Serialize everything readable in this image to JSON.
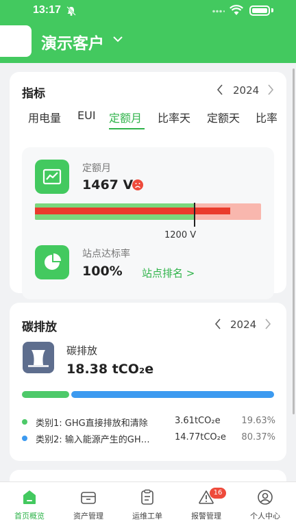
{
  "status_bar": {
    "time": "13:17"
  },
  "header": {
    "title": "演示客户"
  },
  "indicators": {
    "title": "指标",
    "year": "2024",
    "tabs": [
      {
        "label": "用电量"
      },
      {
        "label": "EUI"
      },
      {
        "label": "定额月"
      },
      {
        "label": "比率天"
      },
      {
        "label": "定额天"
      },
      {
        "label": "比率"
      }
    ],
    "active_tab": "定额月",
    "quota": {
      "label": "定额月",
      "value": "1467 V",
      "status": "exceeded"
    },
    "progress": {
      "actual": 1467,
      "target": 1200,
      "max": 1700,
      "target_label": "1200 V"
    },
    "site_rate": {
      "label": "站点达标率",
      "value": "100%",
      "link": "站点排名 >"
    }
  },
  "carbon": {
    "title": "碳排放",
    "year": "2024",
    "metric_label": "碳排放",
    "metric_value": "18.38 tCO₂e",
    "categories": [
      {
        "name": "类别1:  GHG直接排放和清除",
        "amount": "3.61tCO₂e",
        "percent": "19.63%",
        "share": 0.1963,
        "color": "#4dc969"
      },
      {
        "name": "类别2:  输入能源产生的GH…",
        "amount": "14.77tCO₂e",
        "percent": "80.37%",
        "share": 0.8037,
        "color": "#3c9af0"
      }
    ]
  },
  "bottom_nav": {
    "items": [
      {
        "label": "首页概览",
        "icon": "home-icon"
      },
      {
        "label": "资产管理",
        "icon": "asset-box-icon"
      },
      {
        "label": "运维工单",
        "icon": "clipboard-icon"
      },
      {
        "label": "报警管理",
        "icon": "warning-icon",
        "badge": "16"
      },
      {
        "label": "个人中心",
        "icon": "user-icon"
      }
    ]
  },
  "colors": {
    "brand_green": "#43c95f",
    "accent_green": "#2fb34a",
    "alert_red": "#ea3b2c",
    "carbon_blue": "#3c9af0"
  }
}
